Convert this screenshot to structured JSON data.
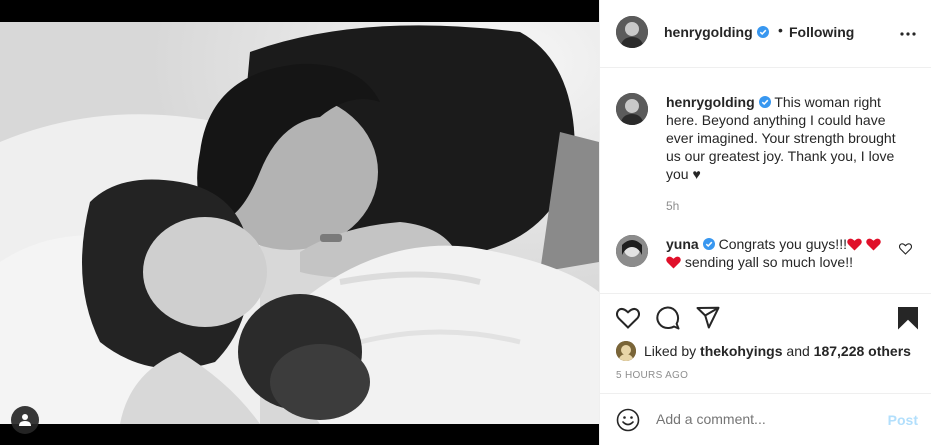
{
  "post": {
    "author": "henrygolding",
    "verified": true,
    "follow_separator": "•",
    "follow_state": "Following",
    "caption": "This woman right here. Beyond anything I could have ever imagined. Your strength brought us our greatest joy. Thank you, I love you ♥",
    "caption_time": "5h"
  },
  "comments": [
    {
      "user": "yuna",
      "verified": true,
      "text_before": "Congrats you guys!!!",
      "text_after": "sending yall so much love!!"
    }
  ],
  "likes": {
    "prefix": "Liked by",
    "user": "thekohyings",
    "joiner": "and",
    "count": "187,228 others"
  },
  "posted_ago": "5 HOURS AGO",
  "composer": {
    "placeholder": "Add a comment...",
    "post_label": "Post"
  },
  "icons": {
    "like": "heart-outline-icon",
    "comment": "comment-bubble-icon",
    "share": "paper-plane-icon",
    "save": "bookmark-filled-icon",
    "more": "ellipsis-icon",
    "tag": "user-tag-icon",
    "emoji": "smiley-icon"
  },
  "colors": {
    "verified": "#3897f0",
    "heart": "#ed4956",
    "post_disabled": "#b2dffc",
    "muted": "#8e8e8e",
    "text": "#262626"
  }
}
